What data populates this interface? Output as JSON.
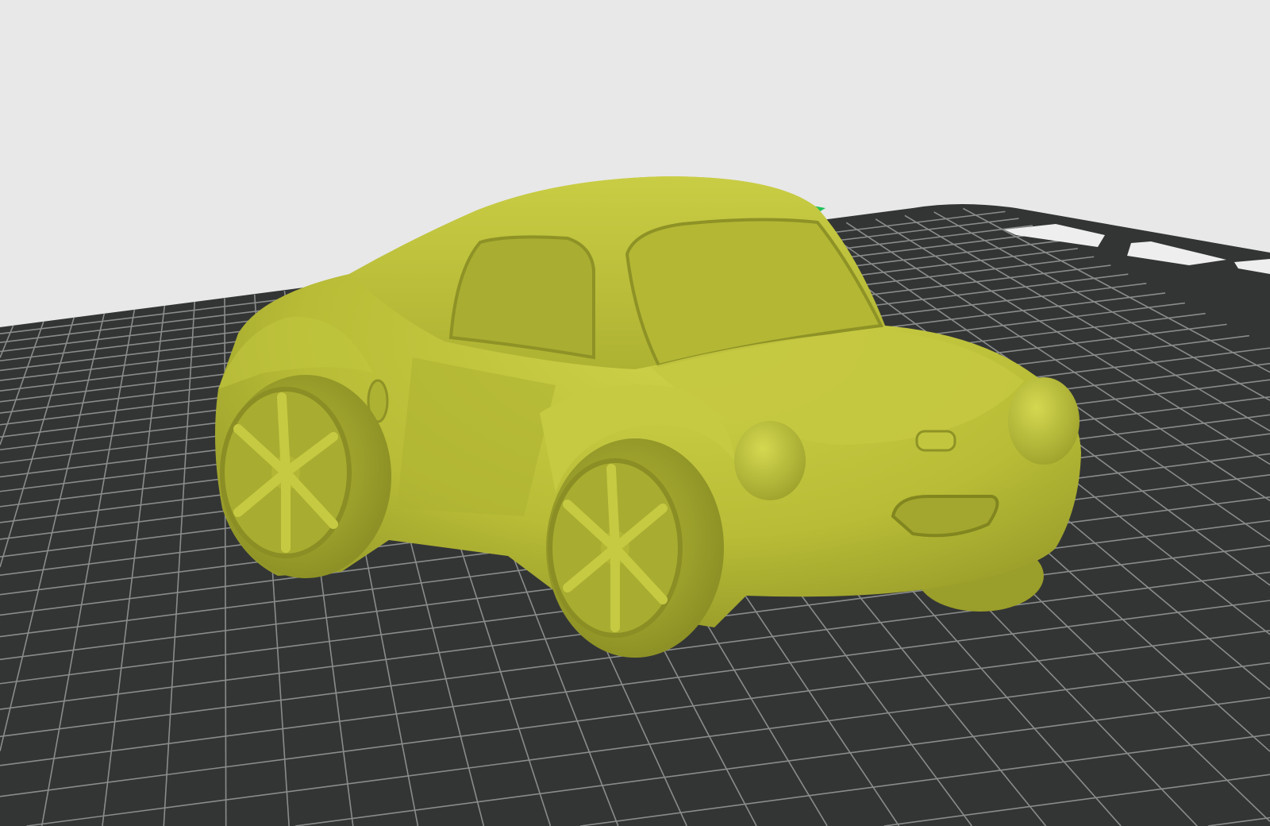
{
  "viewport": {
    "background_color": "#e8e8e8",
    "bed_color": "#333535",
    "grid_line_color": "#8a8c8c",
    "bed_marker_color": "#eeeeee",
    "model_color": "#bcc03a",
    "model_shadow_color": "#8e9226",
    "model_highlight_color": "#d2d64e",
    "axis_indicator_color": "#1fc25a",
    "grid_divisions": 40
  }
}
